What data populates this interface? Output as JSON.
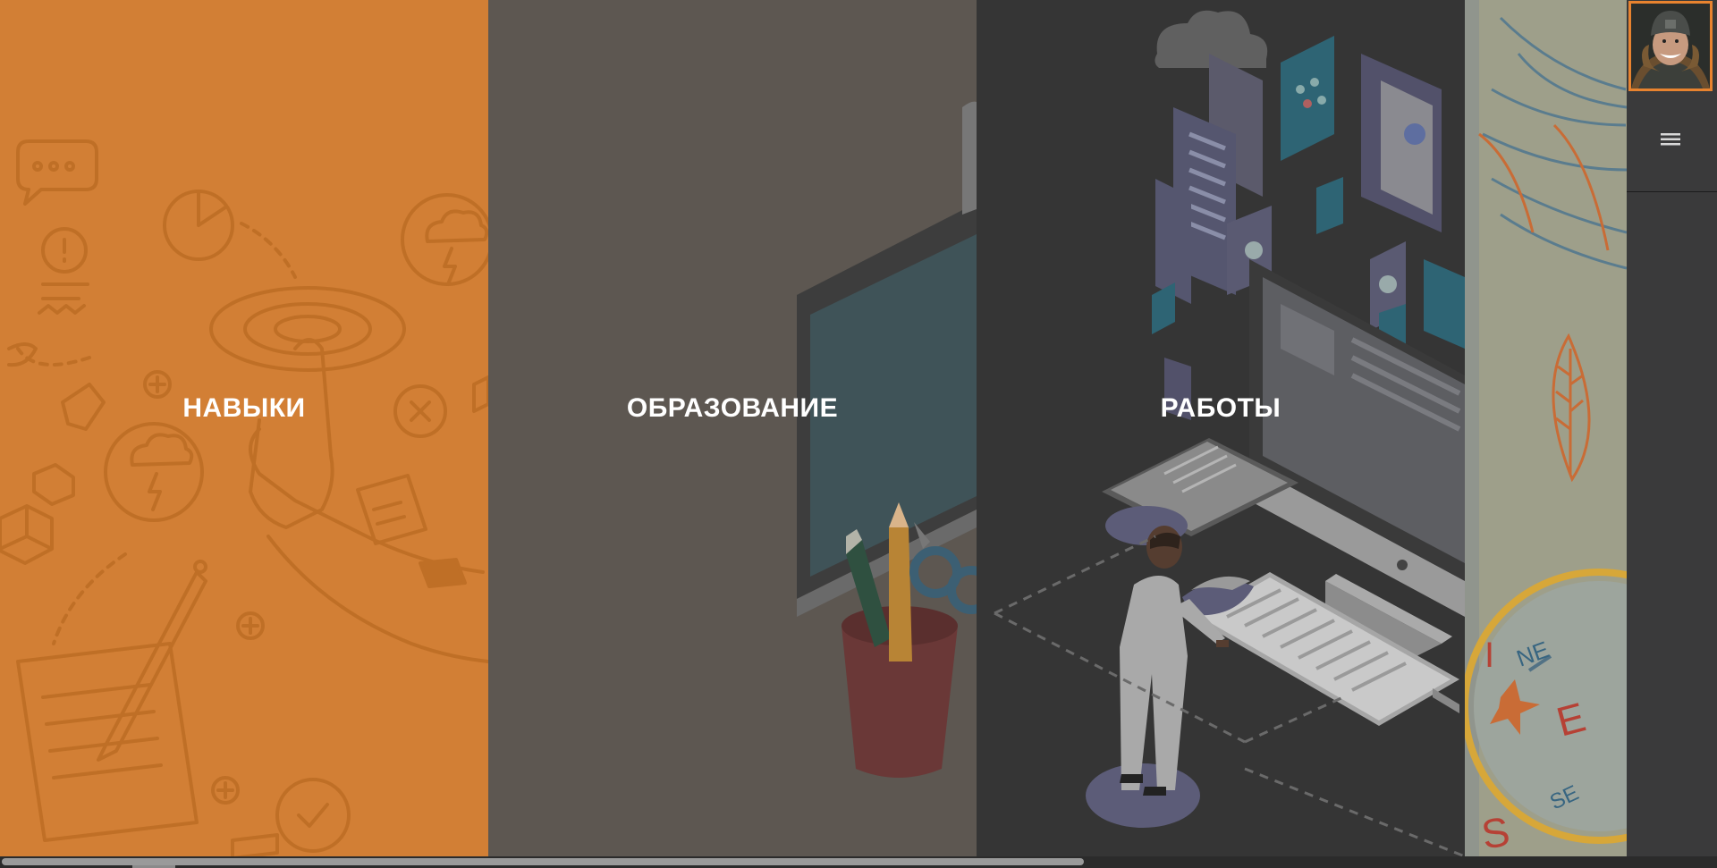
{
  "panels": {
    "skills": {
      "label": "НАВЫКИ",
      "color": "#d27f35"
    },
    "education": {
      "label": "ОБРАЗОВАНИЕ",
      "color": "#5d5751"
    },
    "works": {
      "label": "РАБОТЫ",
      "color": "#353535"
    }
  },
  "sidebar": {
    "avatar_icon": "user-photo",
    "menu_icon": "hamburger-menu-icon",
    "accent": "#e8832f"
  },
  "compass_letters": [
    "NE",
    "E",
    "SE",
    "S"
  ]
}
